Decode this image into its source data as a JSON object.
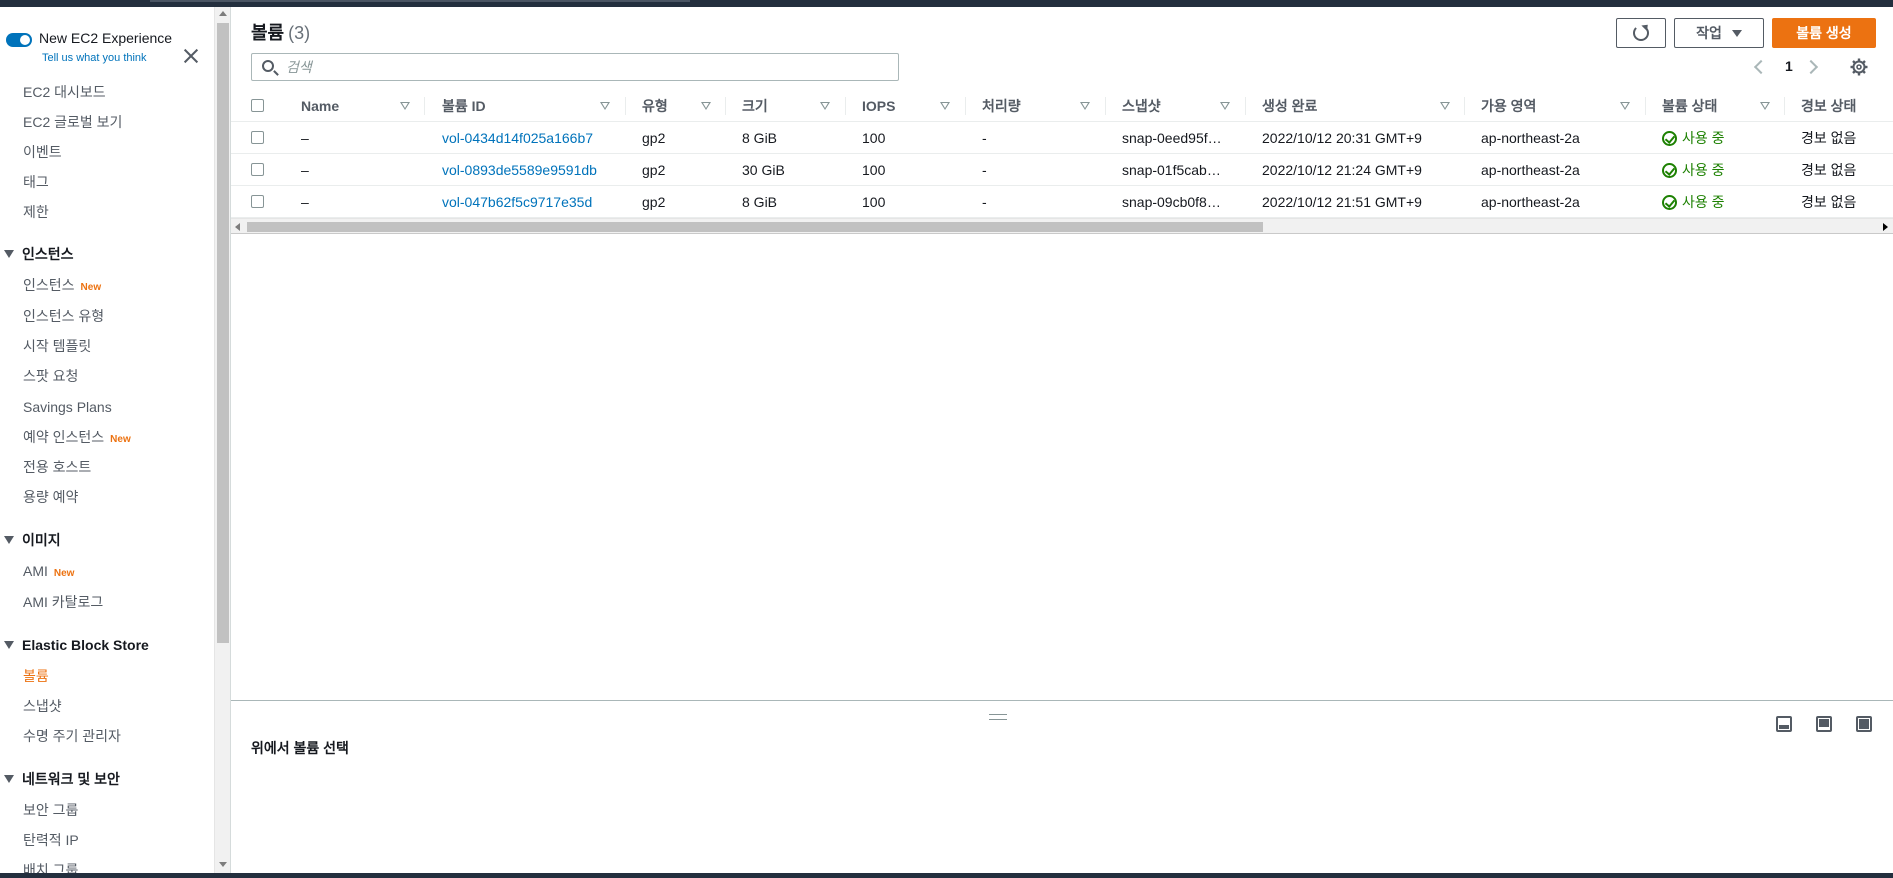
{
  "sidebar": {
    "toggle_title": "New EC2 Experience",
    "toggle_link": "Tell us what you think",
    "items": [
      {
        "label": "EC2 대시보드"
      },
      {
        "label": "EC2 글로벌 보기"
      },
      {
        "label": "이벤트"
      },
      {
        "label": "태그"
      },
      {
        "label": "제한"
      }
    ],
    "sections": [
      {
        "title": "인스턴스",
        "items": [
          {
            "label": "인스턴스",
            "badge": "New"
          },
          {
            "label": "인스턴스 유형"
          },
          {
            "label": "시작 템플릿"
          },
          {
            "label": "스팟 요청"
          },
          {
            "label": "Savings Plans"
          },
          {
            "label": "예약 인스턴스",
            "badge": "New"
          },
          {
            "label": "전용 호스트"
          },
          {
            "label": "용량 예약"
          }
        ]
      },
      {
        "title": "이미지",
        "items": [
          {
            "label": "AMI",
            "badge": "New"
          },
          {
            "label": "AMI 카탈로그"
          }
        ]
      },
      {
        "title": "Elastic Block Store",
        "items": [
          {
            "label": "볼륨",
            "active": true
          },
          {
            "label": "스냅샷"
          },
          {
            "label": "수명 주기 관리자"
          }
        ]
      },
      {
        "title": "네트워크 및 보안",
        "items": [
          {
            "label": "보안 그룹"
          },
          {
            "label": "탄력적 IP"
          },
          {
            "label": "배치 그룹"
          }
        ]
      }
    ]
  },
  "header": {
    "title": "볼륨",
    "count": "(3)",
    "actions_label": "작업",
    "create_label": "볼륨 생성"
  },
  "search": {
    "placeholder": "검색",
    "value": ""
  },
  "pagination": {
    "page": "1"
  },
  "table": {
    "columns": [
      "Name",
      "볼륨 ID",
      "유형",
      "크기",
      "IOPS",
      "처리량",
      "스냅샷",
      "생성 완료",
      "가용 영역",
      "볼륨 상태",
      "경보 상태"
    ],
    "rows": [
      [
        "–",
        "vol-0434d14f025a166b7",
        "gp2",
        "8 GiB",
        "100",
        "-",
        "snap-0eed95f…",
        "2022/10/12 20:31 GMT+9",
        "ap-northeast-2a",
        "사용 중",
        "경보 없음"
      ],
      [
        "–",
        "vol-0893de5589e9591db",
        "gp2",
        "30 GiB",
        "100",
        "-",
        "snap-01f5cab…",
        "2022/10/12 21:24 GMT+9",
        "ap-northeast-2a",
        "사용 중",
        "경보 없음"
      ],
      [
        "–",
        "vol-047b62f5c9717e35d",
        "gp2",
        "8 GiB",
        "100",
        "-",
        "snap-09cb0f8…",
        "2022/10/12 21:51 GMT+9",
        "ap-northeast-2a",
        "사용 중",
        "경보 없음"
      ]
    ]
  },
  "split_panel": {
    "title": "위에서 볼륨 선택"
  },
  "colors": {
    "accent": "#ec7211",
    "link": "#0073bb",
    "success": "#1d8102"
  }
}
